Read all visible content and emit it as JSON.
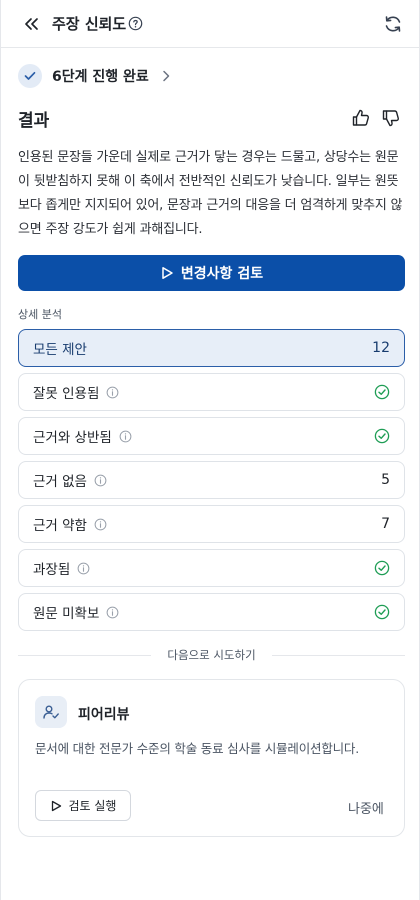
{
  "header": {
    "title": "주장 신뢰도",
    "icons": {
      "collapse": "double-chevron-left-icon",
      "help": "question-circle-icon",
      "refresh": "refresh-icon"
    }
  },
  "step": {
    "label": "6단계 진행 완료",
    "icon": "check-icon"
  },
  "result": {
    "title": "결과",
    "body": "인용된 문장들 가운데 실제로 근거가 닿는 경우는 드물고, 상당수는 원문이 뒷받침하지 못해 이 축에서 전반적인 신뢰도가 낮습니다. 일부는 원뜻보다 좁게만 지지되어 있어, 문장과 근거의 대응을 더 엄격하게 맞추지 않으면 주장 강도가 쉽게 과해집니다."
  },
  "review_button": {
    "label": "변경사항 검토"
  },
  "analysis": {
    "label": "상세 분석",
    "filters": [
      {
        "label": "모든 제안",
        "count": "12",
        "info": false,
        "status": "count",
        "active": true
      },
      {
        "label": "잘못 인용됨",
        "count": "",
        "info": true,
        "status": "ok",
        "active": false
      },
      {
        "label": "근거와 상반됨",
        "count": "",
        "info": true,
        "status": "ok",
        "active": false
      },
      {
        "label": "근거 없음",
        "count": "5",
        "info": true,
        "status": "count",
        "active": false
      },
      {
        "label": "근거 약함",
        "count": "7",
        "info": true,
        "status": "count",
        "active": false
      },
      {
        "label": "과장됨",
        "count": "",
        "info": true,
        "status": "ok",
        "active": false
      },
      {
        "label": "원문 미확보",
        "count": "",
        "info": true,
        "status": "ok",
        "active": false
      }
    ]
  },
  "try_next": {
    "label": "다음으로 시도하기"
  },
  "peer_review": {
    "title": "피어리뷰",
    "description": "문서에 대한 전문가 수준의 학술 동료 심사를 시뮬레이션합니다.",
    "run_label": "검토 실행",
    "later_label": "나중에",
    "icon": "user-check-icon"
  },
  "colors": {
    "primary": "#0b4fa8",
    "success": "#1f9d55",
    "active_bg": "#e7eef8"
  }
}
